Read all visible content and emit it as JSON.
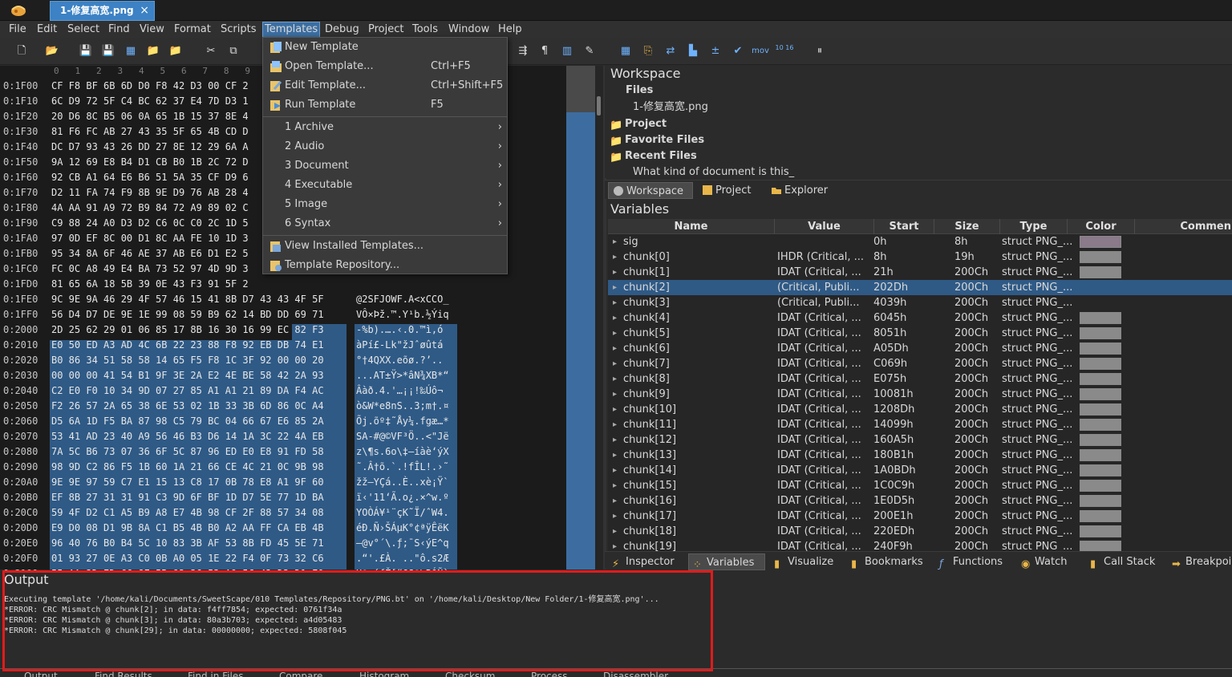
{
  "app": {
    "file_tab": "1-修复高宽.png",
    "close_glyph": "×"
  },
  "menus": [
    "File",
    "Edit",
    "Select",
    "Find",
    "View",
    "Format",
    "Scripts",
    "Templates",
    "Debug",
    "Project",
    "Tools",
    "Window",
    "Help"
  ],
  "templates_menu": {
    "items": [
      {
        "label": "New Template",
        "shortcut": "",
        "arrow": ""
      },
      {
        "label": "Open Template...",
        "shortcut": "Ctrl+F5",
        "arrow": ""
      },
      {
        "label": "Edit Template...",
        "shortcut": "Ctrl+Shift+F5",
        "arrow": ""
      },
      {
        "label": "Run Template",
        "shortcut": "F5",
        "arrow": ""
      },
      {
        "label": "1 Archive",
        "shortcut": "",
        "arrow": "›"
      },
      {
        "label": "2 Audio",
        "shortcut": "",
        "arrow": "›"
      },
      {
        "label": "3 Document",
        "shortcut": "",
        "arrow": "›"
      },
      {
        "label": "4 Executable",
        "shortcut": "",
        "arrow": "›"
      },
      {
        "label": "5 Image",
        "shortcut": "",
        "arrow": "›"
      },
      {
        "label": "6 Syntax",
        "shortcut": "",
        "arrow": "›"
      },
      {
        "label": "View Installed Templates...",
        "shortcut": "",
        "arrow": ""
      },
      {
        "label": "Template Repository...",
        "shortcut": "",
        "arrow": ""
      }
    ]
  },
  "toolbar": {
    "mov_label": "mov",
    "hex_label": "10 16"
  },
  "hex": {
    "column_header": "0   1   2   3   4   5   6   7   8   9   A",
    "rows": [
      {
        "addr": "0:1F00",
        "bytes": "CF F8 BF 6B 6D D0 F8 42 D3 00 CF 2",
        "text": ""
      },
      {
        "addr": "0:1F10",
        "bytes": "6C D9 72 5F C4 BC 62 37 E4 7D D3 1",
        "text": ""
      },
      {
        "addr": "0:1F20",
        "bytes": "20 D6 8C B5 06 0A 65 1B 15 37 8E 4",
        "text": ""
      },
      {
        "addr": "0:1F30",
        "bytes": "81 F6 FC AB 27 43 35 5F 65 4B CD D",
        "text": ""
      },
      {
        "addr": "0:1F40",
        "bytes": "DC D7 93 43 26 DD 27 8E 12 29 6A A",
        "text": ""
      },
      {
        "addr": "0:1F50",
        "bytes": "9A 12 69 E8 B4 D1 CB B0 1B 2C 72 D",
        "text": ""
      },
      {
        "addr": "0:1F60",
        "bytes": "92 CB A1 64 E6 B6 51 5A 35 CF D9 6",
        "text": ""
      },
      {
        "addr": "0:1F70",
        "bytes": "D2 11 FA 74 F9 8B 9E D9 76 AB 28 4",
        "text": ""
      },
      {
        "addr": "0:1F80",
        "bytes": "4A AA 91 A9 72 B9 84 72 A9 89 02 C",
        "text": ""
      },
      {
        "addr": "0:1F90",
        "bytes": "C9 88 24 A0 D3 D2 C6 0C C0 2C 1D 5",
        "text": ""
      },
      {
        "addr": "0:1FA0",
        "bytes": "97 0D EF 8C 00 D1 8C AA FE 10 1D 3",
        "text": ""
      },
      {
        "addr": "0:1FB0",
        "bytes": "95 34 8A 6F 46 AE 37 AB E6 D1 E2 5",
        "text": ""
      },
      {
        "addr": "0:1FC0",
        "bytes": "FC 0C A8 49 E4 BA 73 52 97 4D 9D 3",
        "text": ""
      },
      {
        "addr": "0:1FD0",
        "bytes": "81 65 6A 18 5B 39 0E 43 F3 91 5F 2",
        "text": ""
      },
      {
        "addr": "0:1FE0",
        "bytes": "9C 9E 9A 46 29 4F 57 46 15 41 8B D7 43 43 4F 5F",
        "text": "@2SFJOWF.A<xCCO_"
      },
      {
        "addr": "0:1FF0",
        "bytes": "56 D4 D7 DE 9E 1E 99 08 59 B9 62 14 BD DD 69 71",
        "text": "VÔ×Þž.™.Y¹b.½Ýiq"
      },
      {
        "addr": "0:2000",
        "bytes": "2D 25 62 29 01 06 85 17 8B 16 30 16 99 EC 82 F3",
        "text": "-%b).….‹.0.™ì‚ó"
      },
      {
        "addr": "0:2010",
        "bytes": "E0 50 ED A3 AD 4C 6B 22 23 88 F8 92 EB DB 74 E1",
        "text": "àPí£-Lk\"žJˆøûtá"
      },
      {
        "addr": "0:2020",
        "bytes": "B0 86 34 51 58 58 14 65 F5 F8 1C 3F 92 00 00 20",
        "text": "°†4QXX.eõø.?’.. "
      },
      {
        "addr": "0:2030",
        "bytes": "00 00 00 41 54 B1 9F 3E 2A E2 4E BE 58 42 2A 93",
        "text": "...AT±Ÿ>*âN¾XB*“"
      },
      {
        "addr": "0:2040",
        "bytes": "C2 E0 F0 10 34 9D 07 27 85 A1 A1 21 89 DA F4 AC",
        "text": "Âàð.4.'…¡¡!‰Úô¬"
      },
      {
        "addr": "0:2050",
        "bytes": "F2 26 57 2A 65 38 6E 53 02 1B 33 3B 6D 86 0C A4",
        "text": "ò&W*e8nS..3;m†.¤"
      },
      {
        "addr": "0:2060",
        "bytes": "D5 6A 1D F5 BA 87 98 C5 79 BC 04 66 67 E6 85 2A",
        "text": "Õj.õº‡˜Åy¼.fgæ…*"
      },
      {
        "addr": "0:2070",
        "bytes": "53 41 AD 23 40 A9 56 46 B3 D6 14 1A 3C 22 4A EB",
        "text": "SA-#@©VF³Ö..<\"Jë"
      },
      {
        "addr": "0:2080",
        "bytes": "7A 5C B6 73 07 36 6F 5C 87 96 ED E0 E8 91 FD 58",
        "text": "z\\¶s.6o\\‡–íàè‘ýX"
      },
      {
        "addr": "0:2090",
        "bytes": "98 9D C2 86 F5 1B 60 1A 21 66 CE 4C 21 0C 9B 98",
        "text": "˜.Â†õ.`.!fÎL!.›˜"
      },
      {
        "addr": "0:20A0",
        "bytes": "9E 9E 97 59 C7 E1 15 13 C8 17 0B 78 E8 A1 9F 60",
        "text": "žž—YÇá..È..xè¡Ÿ`"
      },
      {
        "addr": "0:20B0",
        "bytes": "EF 8B 27 31 31 91 C3 9D 6F BF 1D D7 5E 77 1D BA",
        "text": "ï‹'11‘Ã.o¿.×^w.º"
      },
      {
        "addr": "0:20C0",
        "bytes": "59 4F D2 C1 A5 B9 A8 E7 4B 98 CF 2F 88 57 34 08",
        "text": "YOÒÁ¥¹¨çK˜Ï/ˆW4."
      },
      {
        "addr": "0:20D0",
        "bytes": "E9 D0 08 D1 9B 8A C1 B5 4B B0 A2 AA FF CA EB 4B",
        "text": "éÐ.Ñ›ŠÁµK°¢ªÿÊëK"
      },
      {
        "addr": "0:20E0",
        "bytes": "96 40 76 B0 B4 5C 10 83 3B AF 53 8B FD 45 5E 71",
        "text": "–@v°´\\.ƒ;¯S‹ýE^q"
      },
      {
        "addr": "0:20F0",
        "bytes": "01 93 27 0E A3 C0 0B A0 05 1E 22 F4 0F 73 32 C6",
        "text": ".“'.£À. ..\"ô.s2Æ"
      },
      {
        "addr": "0:2100",
        "bytes": "55 AA 2D ED 66 8E 5B 93 36 53 A9 5C 42 D3 D1 E0",
        "text": "Uª-ífŽ[“6S©\\BÓÑà"
      },
      {
        "addr": "0:2110",
        "bytes": "72 AA 86 81 9F 14 57 06 73 42 11 65 D2 A4 87 D0",
        "text": "rª†.Ÿ.W.sB.eÒ¤‡Ð"
      },
      {
        "addr": "0:2120",
        "bytes": "90 4A C7 11 8B AB 40 C0 FB C5 FE 74 7E B9 0C 9B",
        "text": ".JÇ.‹«@ÀûÅþt~¹.›"
      },
      {
        "addr": "0:2130",
        "bytes": "53 2D 32 CF 98 46 C4 64 52 51 DE 54 69 6D 30 3B",
        "text": "S-2Ï˜FÄdRQÞTim0;"
      }
    ]
  },
  "workspace": {
    "title": "Workspace",
    "files_header": "Files",
    "file_name": "1-修复高宽.png",
    "project": "Project",
    "favorite": "Favorite Files",
    "recent": "Recent Files",
    "recent_item": "What kind of document is this_",
    "tabs": [
      "Workspace",
      "Project",
      "Explorer"
    ]
  },
  "variables": {
    "title": "Variables",
    "columns": [
      "Name",
      "Value",
      "Start",
      "Size",
      "Type",
      "Color",
      "Commen"
    ],
    "rows": [
      {
        "name": "sig",
        "value": "",
        "start": "0h",
        "size": "8h",
        "type": "struct PNG_..."
      },
      {
        "name": "chunk[0]",
        "value": "IHDR  (Critical, ...",
        "start": "8h",
        "size": "19h",
        "type": "struct PNG_..."
      },
      {
        "name": "chunk[1]",
        "value": "IDAT  (Critical, ...",
        "start": "21h",
        "size": "200Ch",
        "type": "struct PNG_..."
      },
      {
        "name": "chunk[2]",
        "value": "  (Critical, Publi...",
        "start": "202Dh",
        "size": "200Ch",
        "type": "struct PNG_..."
      },
      {
        "name": "chunk[3]",
        "value": "  (Critical, Publi...",
        "start": "4039h",
        "size": "200Ch",
        "type": "struct PNG_..."
      },
      {
        "name": "chunk[4]",
        "value": "IDAT  (Critical, ...",
        "start": "6045h",
        "size": "200Ch",
        "type": "struct PNG_..."
      },
      {
        "name": "chunk[5]",
        "value": "IDAT  (Critical, ...",
        "start": "8051h",
        "size": "200Ch",
        "type": "struct PNG_..."
      },
      {
        "name": "chunk[6]",
        "value": "IDAT  (Critical, ...",
        "start": "A05Dh",
        "size": "200Ch",
        "type": "struct PNG_..."
      },
      {
        "name": "chunk[7]",
        "value": "IDAT  (Critical, ...",
        "start": "C069h",
        "size": "200Ch",
        "type": "struct PNG_..."
      },
      {
        "name": "chunk[8]",
        "value": "IDAT  (Critical, ...",
        "start": "E075h",
        "size": "200Ch",
        "type": "struct PNG_..."
      },
      {
        "name": "chunk[9]",
        "value": "IDAT  (Critical, ...",
        "start": "10081h",
        "size": "200Ch",
        "type": "struct PNG_..."
      },
      {
        "name": "chunk[10]",
        "value": "IDAT  (Critical, ...",
        "start": "1208Dh",
        "size": "200Ch",
        "type": "struct PNG_..."
      },
      {
        "name": "chunk[11]",
        "value": "IDAT  (Critical, ...",
        "start": "14099h",
        "size": "200Ch",
        "type": "struct PNG_..."
      },
      {
        "name": "chunk[12]",
        "value": "IDAT  (Critical, ...",
        "start": "160A5h",
        "size": "200Ch",
        "type": "struct PNG_..."
      },
      {
        "name": "chunk[13]",
        "value": "IDAT  (Critical, ...",
        "start": "180B1h",
        "size": "200Ch",
        "type": "struct PNG_..."
      },
      {
        "name": "chunk[14]",
        "value": "IDAT  (Critical, ...",
        "start": "1A0BDh",
        "size": "200Ch",
        "type": "struct PNG_..."
      },
      {
        "name": "chunk[15]",
        "value": "IDAT  (Critical, ...",
        "start": "1C0C9h",
        "size": "200Ch",
        "type": "struct PNG_..."
      },
      {
        "name": "chunk[16]",
        "value": "IDAT  (Critical, ...",
        "start": "1E0D5h",
        "size": "200Ch",
        "type": "struct PNG_..."
      },
      {
        "name": "chunk[17]",
        "value": "IDAT  (Critical, ...",
        "start": "200E1h",
        "size": "200Ch",
        "type": "struct PNG_..."
      },
      {
        "name": "chunk[18]",
        "value": "IDAT  (Critical, ...",
        "start": "220EDh",
        "size": "200Ch",
        "type": "struct PNG_..."
      },
      {
        "name": "chunk[19]",
        "value": "IDAT  (Critical, ...",
        "start": "240F9h",
        "size": "200Ch",
        "type": "struct PNG_..."
      }
    ],
    "bottom_tabs": [
      "Inspector",
      "Variables",
      "Visualize",
      "Bookmarks",
      "Functions",
      "Watch",
      "Call Stack",
      "Breakpoi"
    ]
  },
  "output": {
    "title": "Output",
    "lines": [
      "Executing template '/home/kali/Documents/SweetScape/010 Templates/Repository/PNG.bt' on '/home/kali/Desktop/New Folder/1-修复高宽.png'...",
      "*ERROR: CRC Mismatch @ chunk[2]; in data: f4ff7854; expected: 0761f34a",
      "*ERROR: CRC Mismatch @ chunk[3]; in data: 80a3b703; expected: a4d05483",
      "*ERROR: CRC Mismatch @ chunk[29]; in data: 00000000; expected: 5808f045"
    ],
    "tabs": [
      "Output",
      "Find Results",
      "Find in Files",
      "Compare",
      "Histogram",
      "Checksum",
      "Process",
      "Disassembler"
    ]
  },
  "colors": {
    "accent": "#3c82c4",
    "selection": "#2f5a86",
    "highlight_box": "#e21b1b",
    "swatch": "#8a8a8a"
  }
}
